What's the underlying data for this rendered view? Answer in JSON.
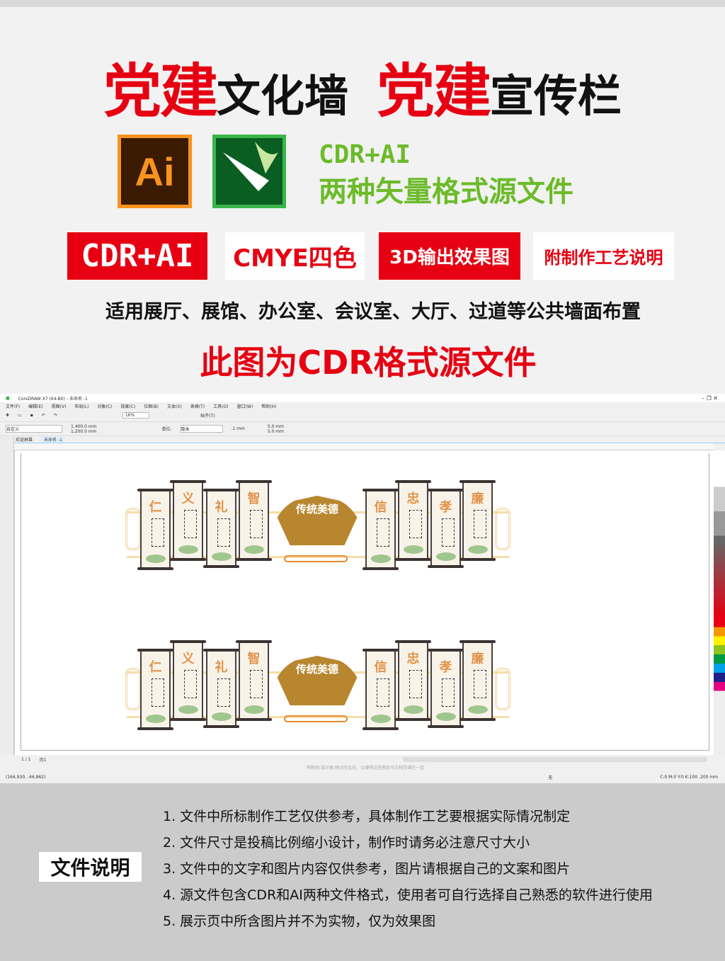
{
  "title": {
    "part1_red": "党建",
    "part1_black": "文化墙",
    "part2_red": "党建",
    "part2_black": "宣传栏"
  },
  "icons": {
    "ai_label": "Ai",
    "ai": "adobe-illustrator-icon",
    "cdr": "coreldraw-icon"
  },
  "formats": {
    "line1": "CDR+AI",
    "line2": "两种矢量格式源文件"
  },
  "badges": [
    "CDR+AI",
    "CMYE四色",
    "3D输出效果图",
    "附制作工艺说明"
  ],
  "usage": "适用展厅、展馆、办公室、会议室、大厅、过道等公共墙面布置",
  "note": "此图为CDR格式源文件",
  "coreldraw": {
    "window_title": "CoreDRAW X7 (64-Bit) - 未命名 -1",
    "menu": [
      "文件(F)",
      "编辑(E)",
      "视图(V)",
      "布局(L)",
      "对象(C)",
      "效果(C)",
      "位图(B)",
      "文本(X)",
      "表格(T)",
      "工具(O)",
      "窗口(W)",
      "帮助(H)"
    ],
    "zoom": "16%",
    "snap": "贴齐(T)",
    "page_preset": "自定义",
    "width": "1,400.0 mm",
    "height": "1,200.0 mm",
    "unit_label": "单位:",
    "unit": "毫米",
    "nudge": ".1 mm",
    "dup_x": "5.0 mm",
    "dup_y": "5.0 mm",
    "tabs": [
      "欢迎屏幕",
      "未命名 -1"
    ],
    "page_nav": "1 / 1",
    "page_tab": "页1",
    "hint": "将颜色(或对象)拖动至此处，以便将这些颜色与文档存储在一起",
    "coords": "(164.930, -46.862)",
    "fill": "无",
    "outline": "C:0 M:0 Y:0 K:100 .200 mm"
  },
  "wall": {
    "center": "传统美德",
    "characters": [
      "仁",
      "义",
      "礼",
      "智",
      "信",
      "忠",
      "孝",
      "廉"
    ]
  },
  "doc": {
    "label": "文件说明",
    "items": [
      "1. 文件中所标制作工艺仅供参考，具体制作工艺要根据实际情况制定",
      "2. 文件尺寸是投稿比例缩小设计，制作时请务必注意尺寸大小",
      "3. 文件中的文字和图片内容仅供参考，图片请根据自己的文案和图片",
      "4. 源文件包含CDR和AI两种文件格式，使用者可自行选择自己熟悉的软件进行使用",
      "5. 展示页中所含图片并不为实物，仅为效果图"
    ]
  }
}
